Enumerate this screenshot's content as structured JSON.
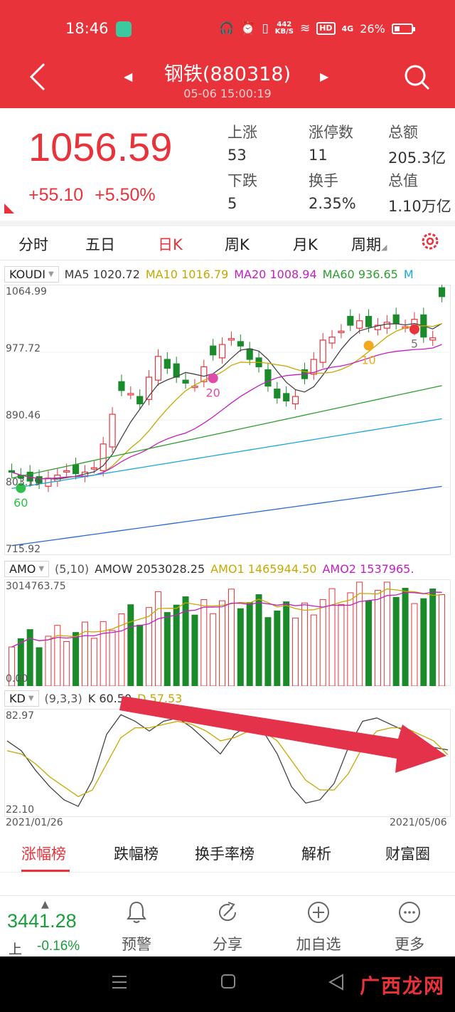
{
  "status_bar": {
    "time": "18:46",
    "net_speed": "442\nKB/S",
    "hd": "HD",
    "signal": "4G",
    "battery": "26%"
  },
  "header": {
    "title": "钢铁(880318)",
    "subtitle": "05-06 15:00:19"
  },
  "quote": {
    "price": "1056.59",
    "change": "+55.10",
    "change_pct": "+5.50%",
    "stats": [
      {
        "label": "上涨",
        "value": "53"
      },
      {
        "label": "涨停数",
        "value": "11"
      },
      {
        "label": "总额",
        "value": "205.3亿"
      },
      {
        "label": "下跌",
        "value": "5"
      },
      {
        "label": "换手",
        "value": "2.35%"
      },
      {
        "label": "总值",
        "value": "1.10万亿"
      }
    ]
  },
  "period_tabs": [
    "分时",
    "五日",
    "日K",
    "周K",
    "月K",
    "周期"
  ],
  "active_period": "日K",
  "kline_panel": {
    "indicator": "KOUDI",
    "ma": [
      {
        "label": "MA5",
        "value": "1020.72",
        "color": "#3a3a3a"
      },
      {
        "label": "MA10",
        "value": "1016.79",
        "color": "#c6a800"
      },
      {
        "label": "MA20",
        "value": "1008.94",
        "color": "#c31fc3"
      },
      {
        "label": "MA60",
        "value": "936.65",
        "color": "#2e9e2e"
      },
      {
        "label": "M",
        "value": "",
        "color": "#1aa8d8"
      }
    ],
    "y_labels": [
      "1064.99",
      "977.72",
      "890.46",
      "803.19",
      "715.92"
    ],
    "markers": [
      "60",
      "20",
      "10",
      "5"
    ]
  },
  "volume_panel": {
    "indicator": "AMO",
    "params": "(5,10)",
    "amow_label": "AMOW",
    "amow_value": "2053028.25",
    "amo1_label": "AMO1",
    "amo1_value": "1465944.50",
    "amo2_label": "AMO2",
    "amo2_value": "1537965.",
    "y_top": "3014763.75",
    "y_bottom": "0.00"
  },
  "kd_panel": {
    "indicator": "KD",
    "params": "(9,3,3)",
    "k_label": "K",
    "k_value": "60.50",
    "d_label": "D",
    "d_value": "57.53",
    "y_top": "82.97",
    "y_bottom": "22.10",
    "date_start": "2021/01/26",
    "date_end": "2021/05/06"
  },
  "chart_data": {
    "type": "candlestick",
    "ylim": [
      715.92,
      1064.99
    ],
    "closes": [
      820,
      812,
      808,
      805,
      812,
      816,
      822,
      818,
      820,
      826,
      858,
      898,
      930,
      926,
      912,
      948,
      976,
      960,
      948,
      940,
      936,
      962,
      978,
      992,
      1000,
      990,
      972,
      962,
      936,
      920,
      916,
      922,
      946,
      972,
      998,
      1002,
      1010,
      1018,
      1024,
      1016,
      1018,
      1022,
      1020,
      1016,
      1026,
      1002,
      1001,
      1056.59
    ],
    "ma60_end": 936.65,
    "kd_k": [
      66,
      60,
      48,
      38,
      30,
      26,
      42,
      70,
      82,
      78,
      72,
      78,
      80,
      74,
      66,
      58,
      70,
      76,
      72,
      58,
      38,
      28,
      30,
      40,
      62,
      78,
      80,
      76,
      72,
      68,
      62,
      60.5
    ],
    "kd_d": [
      60,
      58,
      52,
      44,
      38,
      32,
      36,
      52,
      68,
      74,
      74,
      76,
      78,
      76,
      72,
      66,
      68,
      72,
      72,
      66,
      54,
      42,
      36,
      36,
      46,
      62,
      72,
      74,
      74,
      70,
      66,
      57.53
    ]
  },
  "rank_tabs": [
    "涨幅榜",
    "跌幅榜",
    "换手率榜",
    "解析",
    "财富圈"
  ],
  "bottom_nav": {
    "index_value": "3441.28",
    "index_label": "上",
    "index_pct": "-0.16%",
    "items": [
      "预警",
      "分享",
      "加自选",
      "更多"
    ]
  },
  "watermark": "广西龙网"
}
